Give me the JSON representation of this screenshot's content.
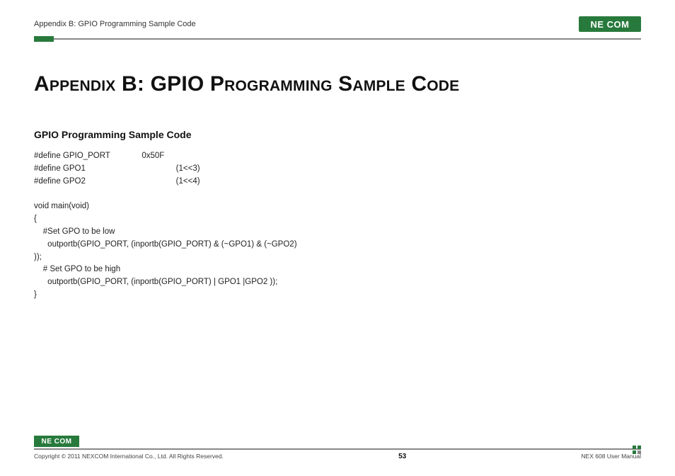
{
  "header": {
    "breadcrumb": "Appendix B: GPIO Programming Sample Code",
    "logo_text": "NE COM"
  },
  "title": "Appendix B: GPIO Programming Sample Code",
  "section_heading": "GPIO Programming Sample Code",
  "code_lines": [
    "#define GPIO_PORT              0x50F",
    "#define GPO1                                        (1<<3)",
    "#define GPO2                                        (1<<4)",
    "",
    "void main(void)",
    "{",
    "    #Set GPO to be low",
    "      outportb(GPIO_PORT, (inportb(GPIO_PORT) & (~GPO1) & (~GPO2)",
    "));",
    "    # Set GPO to be high",
    "      outportb(GPIO_PORT, (inportb(GPIO_PORT) | GPO1 |GPO2 ));",
    "}"
  ],
  "footer": {
    "logo_text": "NE COM",
    "copyright": "Copyright © 2011 NEXCOM International Co., Ltd. All Rights Reserved.",
    "page_number": "53",
    "doc_title": "NEX 608 User Manual"
  }
}
